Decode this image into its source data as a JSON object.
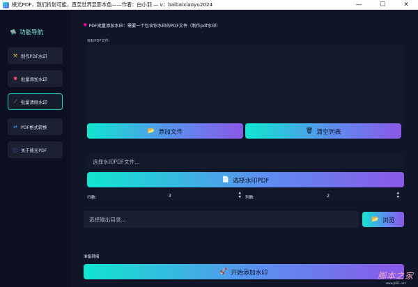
{
  "window": {
    "title": "棱光PDF，我们折射可能，直至世界显影本色——作者：白小羽 — v：baibaixiaoyu2024",
    "minimize": "—",
    "maximize": "☐",
    "close": "✕"
  },
  "sidebar": {
    "title": "功能导航",
    "title_icon": "ufo-icon",
    "items": [
      {
        "label": "制作PDF水印",
        "icon": "tools-icon",
        "active": false
      },
      {
        "label": "批量添加水印",
        "icon": "shield-icon",
        "active": false
      },
      {
        "label": "批量清除水印",
        "icon": "broom-icon",
        "active": true
      },
      {
        "label": "PDF格式转换",
        "icon": "convert-icon",
        "active": false
      },
      {
        "label": "关于棱光PDF",
        "icon": "info-icon",
        "active": false
      }
    ]
  },
  "main": {
    "section_title": "PDF批量添加水印：需要一个包含你水印的PDF文件（制作pdf水印）",
    "list_label": "目标PDF文件:",
    "add_files_label": "添加文件",
    "clear_list_label": "清空列表",
    "watermark_placeholder": "选择水印PDF文件...",
    "select_watermark_label": "选择水印PDF",
    "rows_label": "行数:",
    "rows_value": "3",
    "cols_label": "列数:",
    "cols_value": "2",
    "output_placeholder": "选择输出目录...",
    "browse_label": "浏览",
    "status_text": "准备就绪",
    "start_label": "开始添加水印"
  },
  "watermark": {
    "top": "脚本之家",
    "bottom": "www.jb51.net"
  },
  "colors": {
    "accent_start": "#10e6cf",
    "accent_end": "#8a58e8",
    "background": "#101527",
    "sidebar": "#0c1020"
  }
}
